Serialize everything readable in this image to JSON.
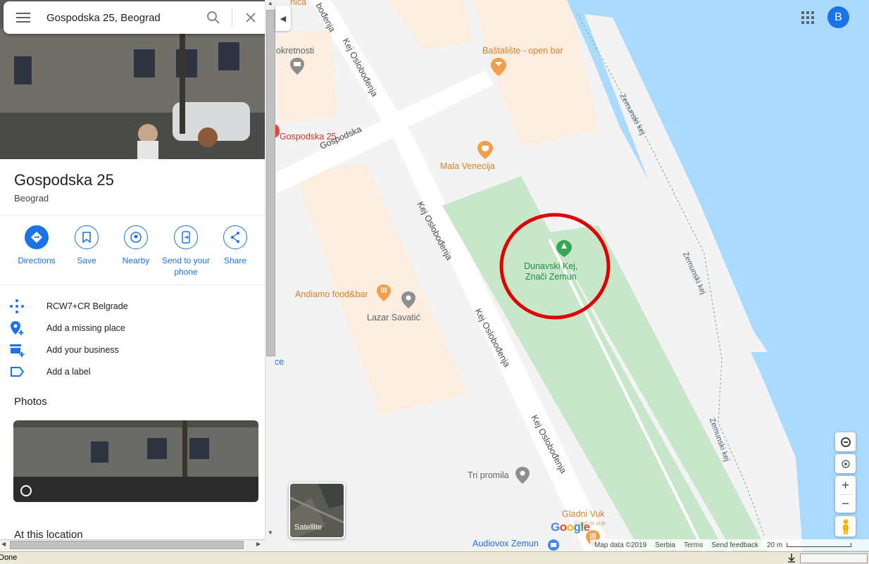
{
  "search": {
    "query": "Gospodska 25, Beograd"
  },
  "place": {
    "title": "Gospodska 25",
    "subtitle": "Beograd"
  },
  "actions": [
    {
      "label": "Directions",
      "icon": "directions-icon"
    },
    {
      "label": "Save",
      "icon": "bookmark-icon"
    },
    {
      "label": "Nearby",
      "icon": "nearby-icon"
    },
    {
      "label": "Send to your\nphone",
      "icon": "send-to-phone-icon"
    },
    {
      "label": "Share",
      "icon": "share-icon"
    }
  ],
  "info_items": [
    {
      "text": "RCW7+CR Belgrade",
      "icon": "plus-code-icon"
    },
    {
      "text": "Add a missing place",
      "icon": "add-place-icon"
    },
    {
      "text": "Add your business",
      "icon": "add-business-icon"
    },
    {
      "text": "Add a label",
      "icon": "label-icon"
    }
  ],
  "sections": {
    "photos": "Photos",
    "at_location": "At this location"
  },
  "map_labels": {
    "nica": "nica",
    "kretnosti": "okretnosti",
    "bastaliste": "Baštalište - open bar",
    "gospodska25": "Gospodska 25",
    "gospodska": "Gospodska",
    "mala_venecija": "Mala Venecija",
    "dunavski": "Dunavski Kej,\nZnači Zemun",
    "andiamo": "Andiamo food&bar",
    "lazar": "Lazar Savatić",
    "ce": "ce",
    "tri_promila": "Tri promila",
    "gladni_vuk": "Gladni Vuk",
    "gladni_vuk_sub": "Glad ni vuk",
    "audiovox": "Audiovox Zemun",
    "kej1": "Kej Oslobođenja",
    "kej2": "Kej Oslobođenja",
    "kej3": "Kej Oslobođenja",
    "kej4": "Kej Oslobođenja",
    "kej5": "Kej Oslobođenja",
    "bodenja": "bođenja",
    "zemunski1": "Zemunski kej",
    "zemunski2": "Zemunski kej",
    "zemunski3": "Zemunski kej"
  },
  "account": {
    "initial": "B"
  },
  "satellite_label": "Satellite",
  "google_logo": "Google",
  "footer": {
    "map_data": "Map data ©2019",
    "serbia": "Serbia",
    "terms": "Terms",
    "feedback": "Send feedback",
    "scale": "20 m"
  },
  "status": {
    "text": "Done"
  },
  "colors": {
    "accent": "#1a73e8",
    "water": "#aadaff",
    "park": "#c8e6c9",
    "pin_red": "#d93025",
    "highlight_circle": "#e00000"
  }
}
